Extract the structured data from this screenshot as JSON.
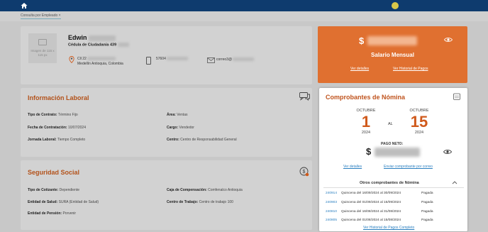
{
  "tab": {
    "label": "Consulta por Empleado"
  },
  "profile": {
    "photo_text": "Imagen de 115 x 115 px",
    "name": "Edwin",
    "cedula": "Cédula de Ciudadanía 439",
    "address_line1": "Cll 22",
    "address_line2": "Medellín Antioquia, Colombia",
    "phone": "57604",
    "email": "correo3@"
  },
  "salary": {
    "currency": "$",
    "label": "Salario Mensual",
    "link_details": "Ver detalles",
    "link_history": "Ver Historial de Pagos"
  },
  "laboral": {
    "title": "Información Laboral",
    "fields": [
      {
        "label": "Tipo de Contrato:",
        "value": "Término Fijo"
      },
      {
        "label": "Área:",
        "value": "Ventas"
      },
      {
        "label": "Fecha de Contratación:",
        "value": "10/07/2024"
      },
      {
        "label": "Cargo:",
        "value": "Vendedor"
      },
      {
        "label": "Jornada Laboral:",
        "value": "Tiempo Completo"
      },
      {
        "label": "Centro:",
        "value": "Centro de Responsabilidad General"
      }
    ]
  },
  "social": {
    "title": "Seguridad Social",
    "fields": [
      {
        "label": "Tipo de Cotizante:",
        "value": "Dependiente"
      },
      {
        "label": "Caja de Compensación:",
        "value": "Comfenalco Antioquia"
      },
      {
        "label": "Entidad de Salud:",
        "value": "SURA (Entidad de Salud)"
      },
      {
        "label": "Centro de Trabajo:",
        "value": "Centro de trabajo 100"
      },
      {
        "label": "Entidad de Pensión:",
        "value": "Porvenir"
      }
    ]
  },
  "nomina": {
    "title": "Comprobantes de Nómina",
    "from": {
      "month": "OCTUBRE",
      "day": "1",
      "year": "2024"
    },
    "separator": "AL",
    "to": {
      "month": "OCTUBRE",
      "day": "15",
      "year": "2024"
    },
    "pago_label": "PAGO NETO:",
    "currency": "$",
    "link_details": "Ver detalles",
    "link_send": "Enviar comprobante por correo",
    "otros_title": "Otros comprobantes de Nómina",
    "rows": [
      {
        "id": "240914",
        "period": "Quincena del 16/09/2024 al 30/09/2024",
        "status": "Pagada"
      },
      {
        "id": "240903",
        "period": "Quincena del 01/09/2024 al 15/09/2024",
        "status": "Pagada"
      },
      {
        "id": "240810",
        "period": "Quincena del 16/08/2024 al 31/08/2024",
        "status": "Pagada"
      },
      {
        "id": "240805",
        "period": "Quincena del 01/08/2024 al 15/08/2024",
        "status": "Pagada"
      }
    ],
    "link_history": "Ver Historial de Pagos Completo"
  }
}
